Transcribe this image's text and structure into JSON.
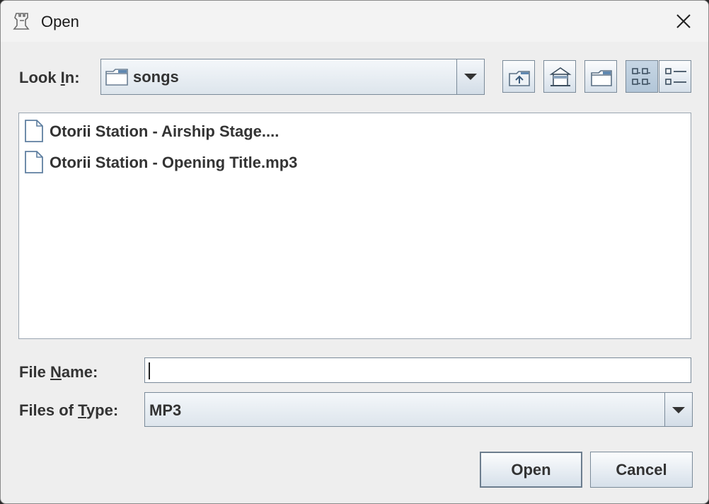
{
  "window": {
    "title": "Open"
  },
  "look_in": {
    "label_pre": "Look ",
    "label_mnemonic": "I",
    "label_post": "n:",
    "value": "songs"
  },
  "toolbar": {
    "up_one_level": "up-folder-icon",
    "home": "home-icon",
    "new_folder": "new-folder-icon",
    "list_view": "list-view-icon",
    "details_view": "details-view-icon"
  },
  "files": [
    {
      "name": "Otorii Station - Airship Stage...."
    },
    {
      "name": "Otorii Station - Opening Title.mp3"
    }
  ],
  "file_name": {
    "label_pre": "File ",
    "label_mnemonic": "N",
    "label_post": "ame:",
    "value": ""
  },
  "file_type": {
    "label_pre": "Files of ",
    "label_mnemonic": "T",
    "label_post": "ype:",
    "value": "MP3"
  },
  "buttons": {
    "open": "Open",
    "cancel": "Cancel"
  },
  "colors": {
    "dialog_bg": "#eeeeee",
    "control_border": "#7a8a99",
    "text": "#333333"
  }
}
